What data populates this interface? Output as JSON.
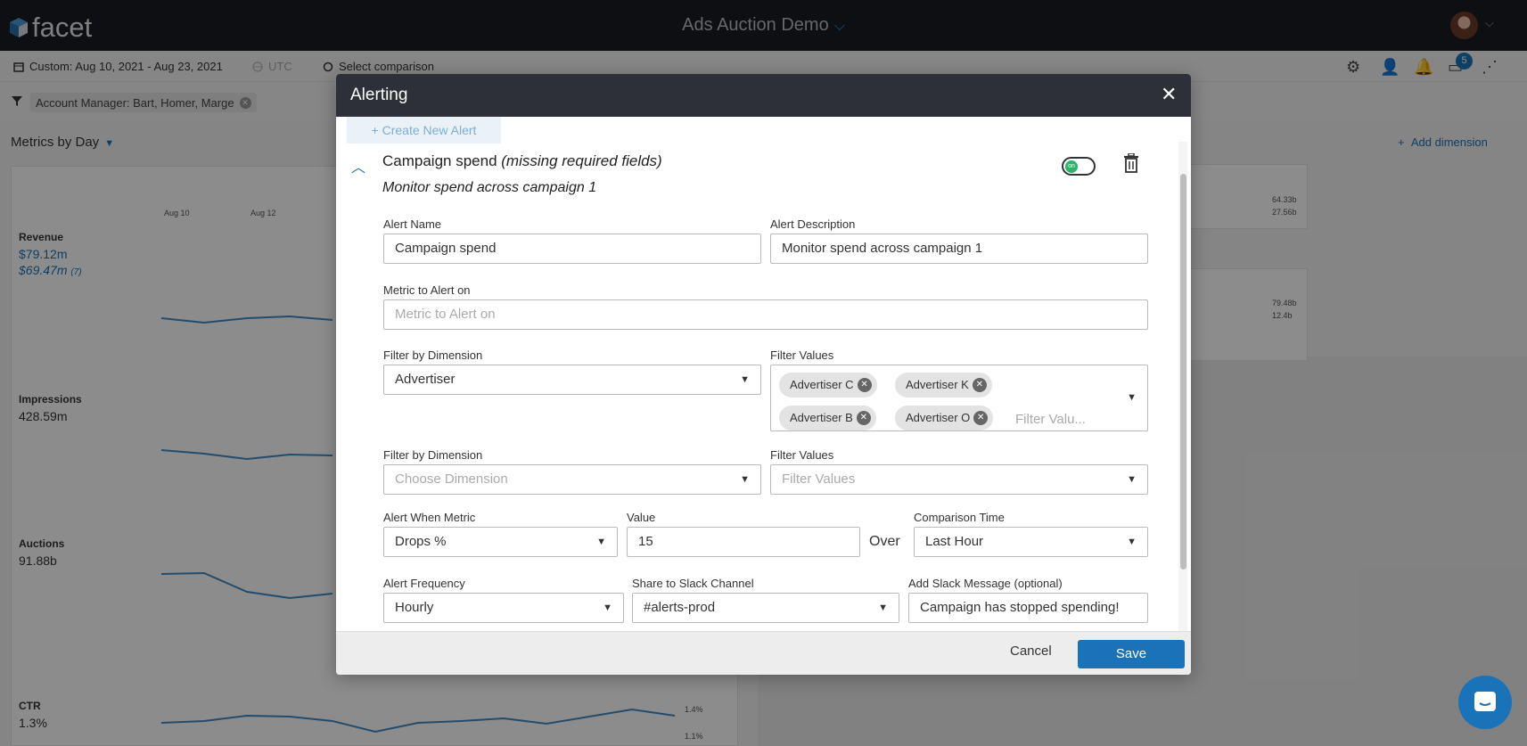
{
  "app": {
    "logo_text": "facet",
    "title": "Ads Auction Demo",
    "notification_count": "5"
  },
  "subbar": {
    "date_range": "Custom: Aug 10, 2021 - Aug 23, 2021",
    "timezone": "UTC",
    "comparison": "Select comparison"
  },
  "filterbar": {
    "chip": "Account Manager: Bart, Homer, Marge"
  },
  "background": {
    "section_title": "Metrics by Day",
    "add_dimension": "Add dimension",
    "dates": [
      "Aug 10",
      "Aug 12"
    ],
    "metrics": [
      {
        "label": "Revenue",
        "value": "$79.12m",
        "compare": "$69.47m",
        "compare_note": "(7)"
      },
      {
        "label": "Impressions",
        "value": "428.59m"
      },
      {
        "label": "Auctions",
        "value": "91.88b"
      },
      {
        "label": "CTR",
        "value": "1.3%"
      }
    ],
    "ctr_ticks": [
      "1.4%",
      "1.1%"
    ],
    "right_panel1": [
      "64.33b",
      "27.56b"
    ],
    "right_panel2": [
      "79.48b",
      "12.4b"
    ]
  },
  "modal": {
    "title": "Alerting",
    "create_new_alert": "+ Create New Alert",
    "alert_heading": "Campaign spend",
    "alert_heading_note": "(missing required fields)",
    "alert_subheading": "Monitor spend across campaign 1",
    "toggle_label": "on",
    "fields": {
      "alert_name_label": "Alert Name",
      "alert_name_value": "Campaign spend",
      "alert_description_label": "Alert Description",
      "alert_description_value": "Monitor spend across campaign 1",
      "metric_label": "Metric to Alert on",
      "metric_placeholder": "Metric to Alert on",
      "filter_dim_label_1": "Filter by Dimension",
      "filter_dim_value_1": "Advertiser",
      "filter_values_label_1": "Filter Values",
      "filter_values_1": [
        "Advertiser C",
        "Advertiser K",
        "Advertiser B",
        "Advertiser O"
      ],
      "filter_values_placeholder_1": "Filter Valu...",
      "filter_dim_label_2": "Filter by Dimension",
      "filter_dim_placeholder_2": "Choose Dimension",
      "filter_values_label_2": "Filter Values",
      "filter_values_placeholder_2": "Filter Values",
      "alert_when_label": "Alert When Metric",
      "alert_when_value": "Drops %",
      "value_label": "Value",
      "value_value": "15",
      "over_text": "Over",
      "comparison_time_label": "Comparison Time",
      "comparison_time_value": "Last Hour",
      "frequency_label": "Alert Frequency",
      "frequency_value": "Hourly",
      "slack_channel_label": "Share to Slack Channel",
      "slack_channel_value": "#alerts-prod",
      "slack_message_label": "Add Slack Message (optional)",
      "slack_message_value": "Campaign has stopped spending!"
    },
    "cancel": "Cancel",
    "save": "Save"
  }
}
